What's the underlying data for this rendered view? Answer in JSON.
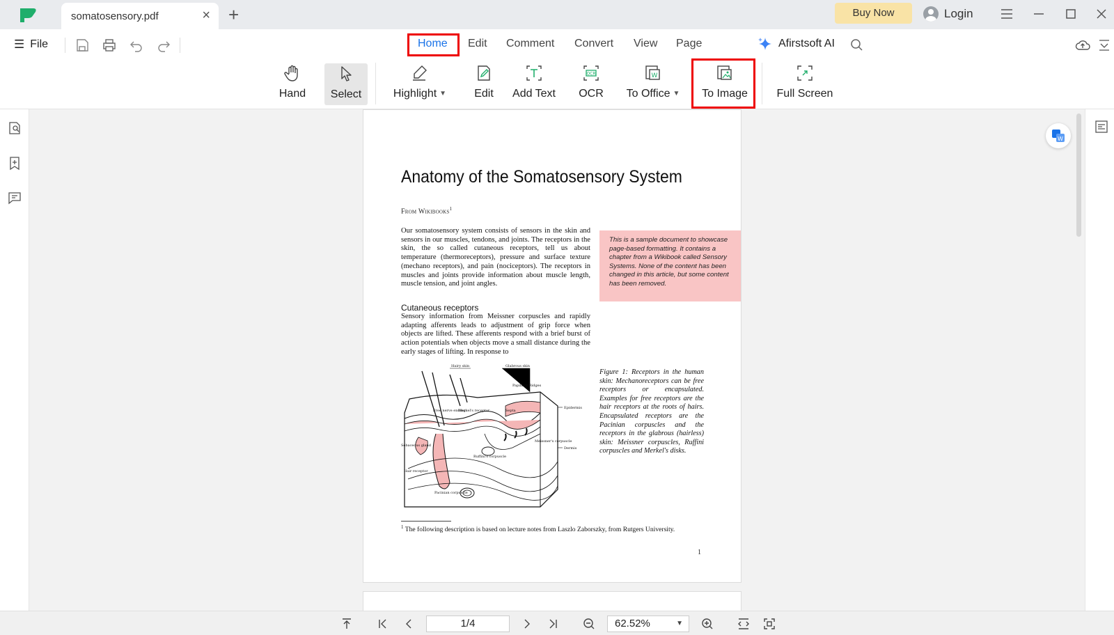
{
  "titlebar": {
    "tab_title": "somatosensory.pdf",
    "buy_now": "Buy Now",
    "login": "Login"
  },
  "menubar": {
    "file": "File",
    "tabs": [
      "Home",
      "Edit",
      "Comment",
      "Convert",
      "View",
      "Page"
    ],
    "active_tab": "Home",
    "ai_label": "Afirstsoft AI"
  },
  "toolbar": {
    "hand": "Hand",
    "select": "Select",
    "highlight": "Highlight",
    "edit": "Edit",
    "add_text": "Add Text",
    "ocr": "OCR",
    "to_office": "To Office",
    "to_image": "To Image",
    "full_screen": "Full Screen"
  },
  "document": {
    "title": "Anatomy of the Somatosensory System",
    "from": "From Wikibooks",
    "from_sup": "1",
    "para1": "Our somatosensory system consists of sensors in the skin and sensors in our muscles, tendons, and joints. The receptors in the skin, the so called cutaneous receptors, tell us about temperature (thermoreceptors), pressure and surface texture (mechano receptors), and pain (nociceptors). The receptors in muscles and joints provide information about muscle length, muscle tension, and joint angles.",
    "note": "This is a sample document to showcase page-based formatting. It contains a chapter from a Wikibook called Sensory Systems. None of the content has been changed in this article, but some content has been removed.",
    "heading": "Cutaneous receptors",
    "para2": "Sensory information from Meissner corpuscles and rapidly adapting afferents leads to adjustment of grip force when objects are lifted. These afferents respond with a brief burst of action potentials when objects move a small distance during the early stages of lifting. In response to",
    "caption": "Figure 1: Receptors in the human skin: Mechanoreceptors can be free receptors or encapsulated. Examples for free receptors are the hair receptors at the roots of hairs. Encapsulated receptors are the Pacinian corpuscles and the receptors in the glabrous (hairless) skin: Meissner corpuscles, Ruffini corpuscles and Merkel's disks.",
    "figure_labels": {
      "hairy_skin": "Hairy skin",
      "glabrous_skin": "Glabrous skin",
      "papillary_ridges": "Papillary Ridges",
      "epidermis": "Epidermis",
      "dermis": "Dermis",
      "free_nerve": "Free nerve ending",
      "merkel": "Merkel's receptor",
      "septa": "Septa",
      "sebaceous": "Sebaceous gland",
      "meissner": "Meissner's corpuscle",
      "ruffini": "Ruffini's corpuscle",
      "hair_receptor": "Hair receptor",
      "pacinian": "Pacinian corpuscle"
    },
    "footnote_sup": "1",
    "footnote": "The following description is based on lecture notes from Laszlo Zaborszky, from Rutgers University.",
    "page_number": "1"
  },
  "bottombar": {
    "page_indicator": "1/4",
    "zoom": "62.52%"
  },
  "colors": {
    "accent": "#1a73e8",
    "highlight_box": "#e00000",
    "note_background": "#f9c5c5",
    "buy_now_background": "#f9e3a6"
  }
}
